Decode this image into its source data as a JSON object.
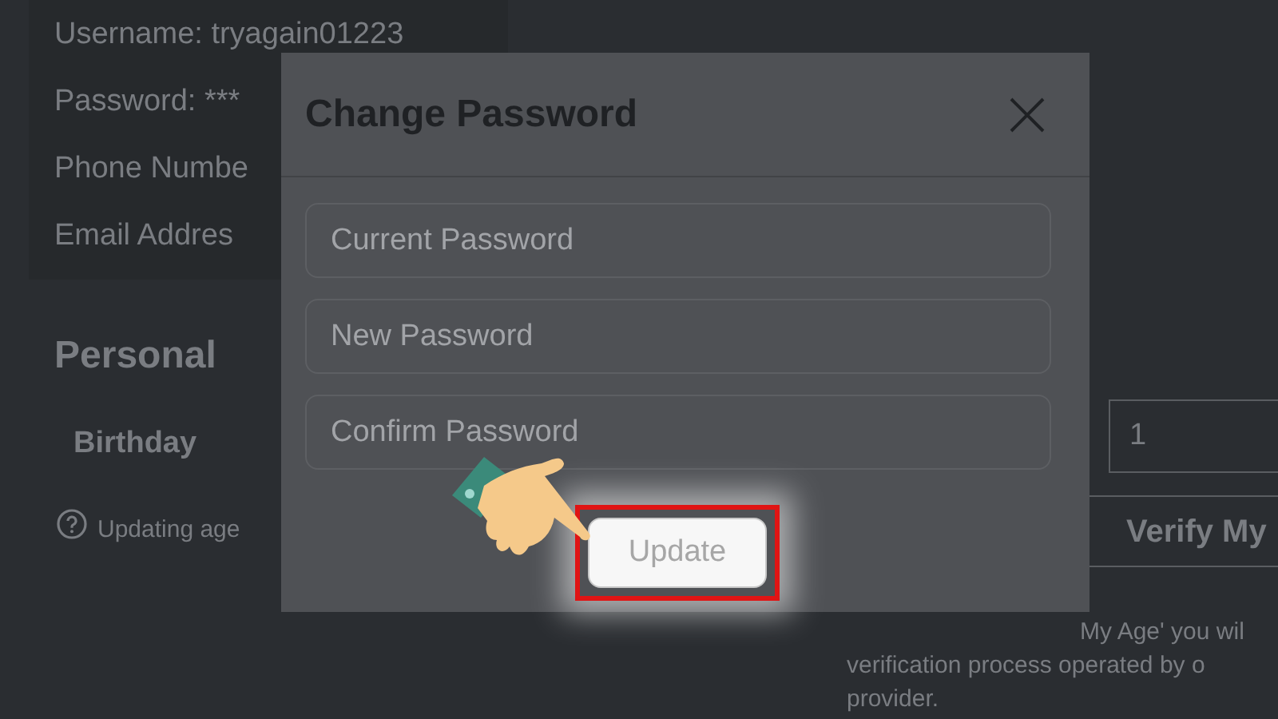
{
  "account_info": [
    "Username: tryagain01223",
    "Password: ***",
    "Phone Numbe",
    "Email Addres"
  ],
  "personal": {
    "heading": "Personal",
    "birthday_label": "Birthday",
    "birthday_day": "1",
    "age_note": "Updating age",
    "verify_button": "Verify My",
    "verify_text": [
      "My Age' you wil",
      "verification process operated by o",
      "provider."
    ]
  },
  "modal": {
    "title": "Change Password",
    "fields": [
      {
        "placeholder": "Current Password"
      },
      {
        "placeholder": "New Password"
      },
      {
        "placeholder": "Confirm Password"
      }
    ],
    "submit": {
      "label": "Update",
      "highlighted": true
    }
  }
}
